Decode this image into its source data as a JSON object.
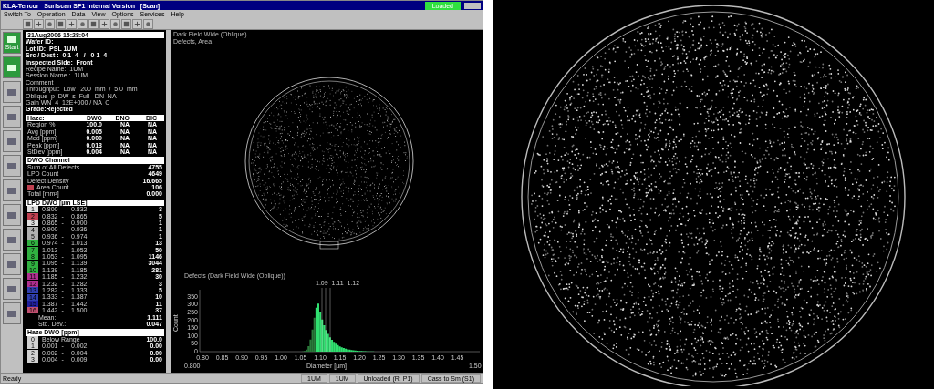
{
  "window": {
    "title": "KLA-Tencor   Surfscan SP1 Internal Version   [Scan]",
    "status_button": "Loaded"
  },
  "menu": [
    "Switch To",
    "Operation",
    "Data",
    "View",
    "Options",
    "Services",
    "Help"
  ],
  "side_tiles": [
    {
      "label": "Start",
      "kind": "green"
    },
    {
      "kind": "green"
    },
    {
      "kind": "gray"
    },
    {
      "kind": "gray"
    },
    {
      "kind": "gray"
    },
    {
      "kind": "gray"
    },
    {
      "kind": "gray"
    },
    {
      "kind": "gray"
    },
    {
      "kind": "gray"
    },
    {
      "kind": "gray"
    },
    {
      "kind": "gray"
    },
    {
      "kind": "gray"
    }
  ],
  "info": {
    "timestamp": "31Aug2006  15:28:04",
    "lines": [
      {
        "text": "Wafer ID:",
        "bold": true
      },
      {
        "text": "Lot ID:  PSL 1UM",
        "bold": true
      },
      {
        "text": "Src / Dest :  0 1  4   /   0 1  4",
        "bold": true
      },
      {
        "text": "Inspected Side:  Front",
        "bold": true
      },
      {
        "text": "Recipe Name:  1UM",
        "bold": false
      },
      {
        "text": "Session Name :  1UM",
        "bold": false
      },
      {
        "text": "Comment",
        "bold": false
      },
      {
        "text": "Throughput:  Low   200  mm  /  5.0  mm",
        "bold": false
      },
      {
        "text": "Oblique  p  DW  s  Full   DN  NA",
        "bold": false
      },
      {
        "text": "Gain WN  4  12E+000 / NA  C",
        "bold": false
      },
      {
        "text": "Grade:Rejected",
        "bold": true
      }
    ]
  },
  "haze_table": {
    "columns": [
      "Haze:",
      "DWO",
      "DNO",
      "DIC"
    ],
    "rows": [
      [
        "Region %",
        "100.0",
        "NA",
        "NA"
      ],
      [
        "Avg [ppm]",
        "0.005",
        "NA",
        "NA"
      ],
      [
        "Med [ppm]",
        "0.000",
        "NA",
        "NA"
      ],
      [
        "Peak [ppm]",
        "0.013",
        "NA",
        "NA"
      ],
      [
        "StDev [ppm]",
        "0.004",
        "NA",
        "NA"
      ]
    ]
  },
  "dwo_channel": {
    "title": "DWO Channel",
    "rows": [
      {
        "label": "Sum of All Defects",
        "value": "4755"
      },
      {
        "label": "LPD Count",
        "value": "4649"
      },
      {
        "label": "Defect Density",
        "value": "16.665"
      },
      {
        "label": "Area Count",
        "value": "106",
        "color": "#c04050"
      },
      {
        "label": "Total [mm²]",
        "value": "0.000"
      }
    ]
  },
  "lpd_bins": {
    "title": "LPD DWO [µm LSE]",
    "rows": [
      {
        "code": "1",
        "color": "#e0e0e0",
        "from": "0.800  -",
        "to": "0.832",
        "count": "3"
      },
      {
        "code": "2",
        "color": "#c04050",
        "from": "0.832  -",
        "to": "0.865",
        "count": "5"
      },
      {
        "code": "3",
        "color": "#e0e0e0",
        "from": "0.865  -",
        "to": "0.900",
        "count": "1"
      },
      {
        "code": "4",
        "color": "#b0b0b0",
        "from": "0.900  -",
        "to": "0.936",
        "count": "1"
      },
      {
        "code": "5",
        "color": "#b0b0b0",
        "from": "0.936  -",
        "to": "0.974",
        "count": "1"
      },
      {
        "code": "6",
        "color": "#30b040",
        "from": "0.974  -",
        "to": "1.013",
        "count": "13"
      },
      {
        "code": "7",
        "color": "#30b040",
        "from": "1.013  -",
        "to": "1.053",
        "count": "50"
      },
      {
        "code": "8",
        "color": "#30b040",
        "from": "1.053  -",
        "to": "1.095",
        "count": "1146"
      },
      {
        "code": "9",
        "color": "#30b040",
        "from": "1.095  -",
        "to": "1.139",
        "count": "3044"
      },
      {
        "code": "10",
        "color": "#30b040",
        "from": "1.139  -",
        "to": "1.185",
        "count": "281"
      },
      {
        "code": "11",
        "color": "#b03090",
        "from": "1.185  -",
        "to": "1.232",
        "count": "30"
      },
      {
        "code": "12",
        "color": "#b03090",
        "from": "1.232  -",
        "to": "1.282",
        "count": "3"
      },
      {
        "code": "13",
        "color": "#3040b0",
        "from": "1.282  -",
        "to": "1.333",
        "count": "5"
      },
      {
        "code": "14",
        "color": "#3040b0",
        "from": "1.333  -",
        "to": "1.387",
        "count": "10"
      },
      {
        "code": "15",
        "color": "#2020a0",
        "from": "1.387  -",
        "to": "1.442",
        "count": "11"
      },
      {
        "code": "16",
        "color": "#c05070",
        "from": "1.442  -",
        "to": "1.500",
        "count": "37"
      }
    ],
    "stats": [
      {
        "label": "Mean:",
        "value": "1.111"
      },
      {
        "label": "Std. Dev.:",
        "value": "0.047"
      }
    ]
  },
  "haze_bins": {
    "title": "Haze DWO [ppm]",
    "rows": [
      {
        "code": "0",
        "from": "Below Range",
        "value": "100.0"
      },
      {
        "code": "1",
        "from": "0.001  -",
        "to": "0.002",
        "value": "0.00"
      },
      {
        "code": "2",
        "from": "0.002  -",
        "to": "0.004",
        "value": "0.00"
      },
      {
        "code": "3",
        "from": "0.004  -",
        "to": "0.009",
        "value": "0.00"
      }
    ]
  },
  "wafer_map": {
    "title": "Dark Field Wide (Oblique)",
    "subtitle": "Defects, Area"
  },
  "histogram": {
    "title": "Defects (Dark Field Wide (Oblique))",
    "markers": "1.09  1.11  1.12",
    "ylabel": "Count",
    "xlabel": "Diameter [µm]",
    "yticks": [
      "350",
      "300",
      "250",
      "200",
      "150",
      "100",
      "50",
      "0"
    ],
    "xticks": [
      "0.80",
      "0.85",
      "0.90",
      "0.95",
      "1.00",
      "1.05",
      "1.10",
      "1.15",
      "1.20",
      "1.25",
      "1.30",
      "1.35",
      "1.40",
      "1.45"
    ],
    "x_start": "0.800",
    "x_end": "1.50"
  },
  "status_bar": [
    "Ready",
    "1UM",
    "1UM",
    "Unloaded (R, P1)",
    "Cass to Sm (S1)"
  ]
}
